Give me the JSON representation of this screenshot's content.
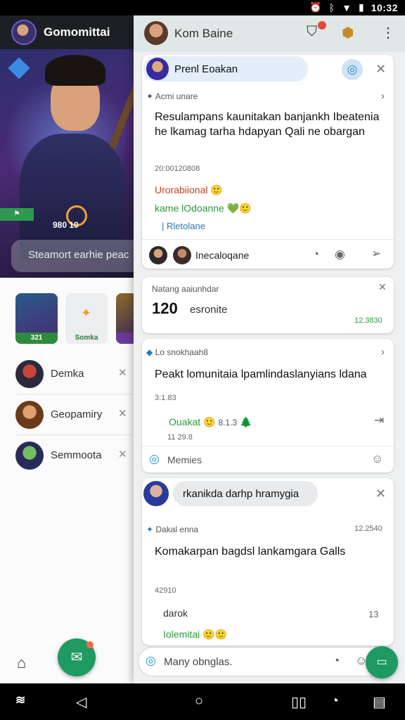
{
  "status_bar": {
    "time": "10:32"
  },
  "left_panel": {
    "profile_name": "Gomomittai",
    "hero_stat": "980 10",
    "search_placeholder": "Steamort earhie peac",
    "tiles": [
      {
        "label": "321"
      },
      {
        "label": "Somka"
      },
      {
        "label": ""
      }
    ],
    "rows": [
      {
        "name": "Demka"
      },
      {
        "name": "Geopamiry"
      },
      {
        "name": "Semmoota"
      }
    ]
  },
  "right_panel": {
    "header_title": "Kom Baine",
    "card1": {
      "pill_text": "Prenl Eoakan",
      "meta": "Acmi unare",
      "body": "Resulampans kaunitakan banjankh Ibeatenia he lkamag tarha hdapyan Qali ne obargan",
      "timestamp": "20:00120808",
      "tag1": "Urorabiional",
      "tag2": "kame lOdoanne",
      "tag3": "Rletolane",
      "footer_name": "Inecaloqane"
    },
    "card2": {
      "label": "Natang aaiunhdar",
      "value": "120",
      "value_suffix": "esronite",
      "status": "12.3830"
    },
    "card3": {
      "meta": "Lo snokhaah8",
      "body": "Peakt lomunitaia lpamlindaslanyians ldana",
      "num1": "3:1.83",
      "tag": "Ouakat",
      "tag_num": "8.1.3",
      "num2": "11 29.8",
      "footer_label": "Memies"
    },
    "card4": {
      "pill_text": "rkanikda darhp hramygia",
      "meta": "Dakal enna",
      "meta_time": "12.2540",
      "body": "Komakarpan bagdsl lankamgara Galls",
      "num": "42910",
      "line1": "darok",
      "line1_num": "13",
      "tag": "Iolemitai"
    },
    "composer_placeholder": "Many obnglas."
  }
}
